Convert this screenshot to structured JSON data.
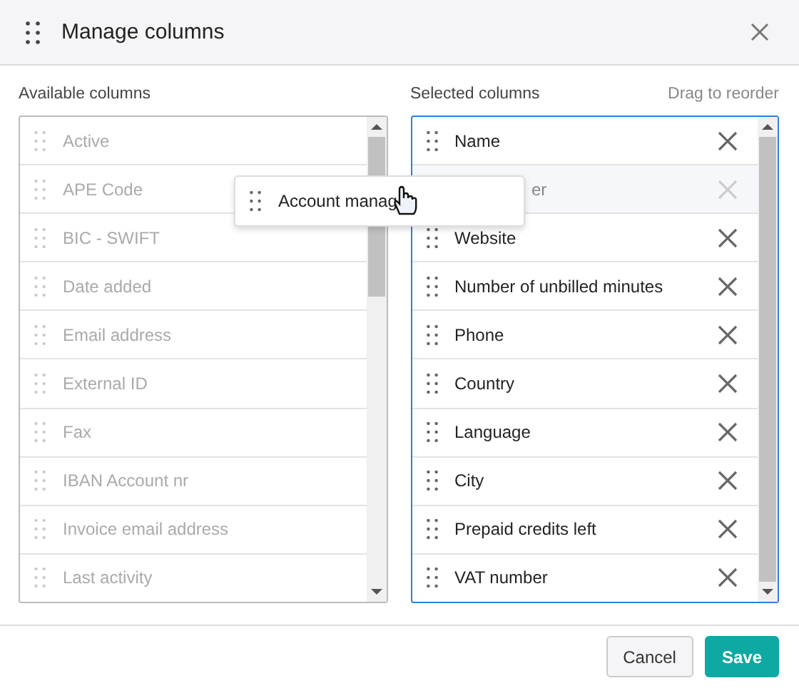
{
  "dialog": {
    "title": "Manage columns"
  },
  "available": {
    "label": "Available columns",
    "items": [
      {
        "label": "Active"
      },
      {
        "label": "APE Code"
      },
      {
        "label": "BIC - SWIFT"
      },
      {
        "label": "Date added"
      },
      {
        "label": "Email address"
      },
      {
        "label": "External ID"
      },
      {
        "label": "Fax"
      },
      {
        "label": "IBAN Account nr"
      },
      {
        "label": "Invoice email address"
      },
      {
        "label": "Last activity"
      }
    ]
  },
  "selected": {
    "label": "Selected columns",
    "hint": "Drag to reorder",
    "items": [
      {
        "kind": "item",
        "label": "Name"
      },
      {
        "kind": "placeholder",
        "label": "er"
      },
      {
        "kind": "item",
        "label": "Website"
      },
      {
        "kind": "item",
        "label": "Number of unbilled minutes"
      },
      {
        "kind": "item",
        "label": "Phone"
      },
      {
        "kind": "item",
        "label": "Country"
      },
      {
        "kind": "item",
        "label": "Language"
      },
      {
        "kind": "item",
        "label": "City"
      },
      {
        "kind": "item",
        "label": "Prepaid credits left"
      },
      {
        "kind": "item",
        "label": "VAT number"
      }
    ]
  },
  "drag_ghost": {
    "label": "Account manag"
  },
  "buttons": [
    {
      "kind": "secondary",
      "label": "Cancel"
    },
    {
      "kind": "primary",
      "label": "Save"
    }
  ]
}
